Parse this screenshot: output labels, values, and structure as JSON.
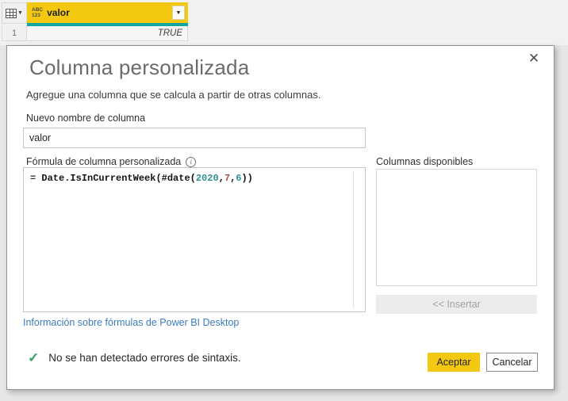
{
  "grid": {
    "corner_caret": "▼",
    "column": {
      "type_line1": "ABC",
      "type_line2": "123",
      "name": "valor",
      "dropdown_caret": "▼"
    },
    "row": {
      "number": "1",
      "value": "TRUE"
    }
  },
  "dialog": {
    "close_icon": "✕",
    "title": "Columna personalizada",
    "subtitle": "Agregue una columna que se calcula a partir de otras columnas.",
    "name_field": {
      "label": "Nuevo nombre de columna",
      "value": "valor"
    },
    "formula_field": {
      "label": "Fórmula de columna personalizada",
      "info_icon": "i",
      "segments": [
        {
          "t": "= ",
          "c": "#3a3a3a"
        },
        {
          "t": "Date.IsInCurrentWeek",
          "c": "#141414"
        },
        {
          "t": "(#date(",
          "c": "#141414"
        },
        {
          "t": "2020",
          "c": "#2e918c"
        },
        {
          "t": ",",
          "c": "#141414"
        },
        {
          "t": "7",
          "c": "#a0524a"
        },
        {
          "t": ",",
          "c": "#141414"
        },
        {
          "t": "6",
          "c": "#2e918c"
        },
        {
          "t": "))",
          "c": "#141414"
        }
      ]
    },
    "available_columns": {
      "label": "Columnas disponibles",
      "items": [],
      "insert_button": "<< Insertar"
    },
    "help_link": "Información sobre fórmulas de Power BI Desktop",
    "status": {
      "icon": "✓",
      "text": "No se han detectado errores de sintaxis."
    },
    "accept_button": "Aceptar",
    "cancel_button": "Cancelar"
  },
  "colors": {
    "brand_yellow": "#f2c811",
    "header_teal": "#10a5a0",
    "link_blue": "#3a7cbc",
    "status_green": "#36a065",
    "number_teal": "#2e918c",
    "number_red": "#a0524a"
  }
}
